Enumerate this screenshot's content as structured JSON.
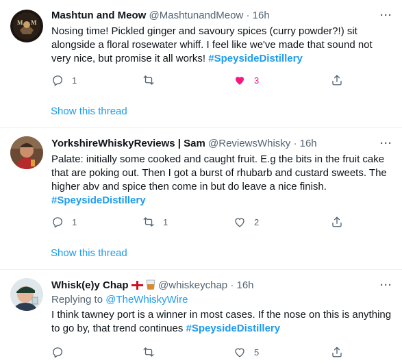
{
  "tweets": [
    {
      "name": "Mashtun and Meow",
      "handle": "@MashtunandMeow",
      "dot": "·",
      "time": "16h",
      "more": "···",
      "text": "Nosing time! Pickled ginger and savoury spices (curry powder?!) sit alongside a floral rosewater whiff. I feel like we've made that sound not very nice, but promise it all works! ",
      "hashtag": "#SpeysideDistillery",
      "reply_count": "1",
      "retweet_count": "",
      "like_count": "3",
      "liked": true,
      "show_thread": "Show this thread"
    },
    {
      "name": "YorkshireWhiskyReviews | Sam",
      "handle": "@ReviewsWhisky",
      "dot": "·",
      "time": "16h",
      "more": "···",
      "text": "Palate: initially some cooked and caught fruit. E.g the bits in the fruit cake that are poking out. Then I got a burst of rhubarb and custard sweets. The higher abv and spice then come in but do leave a nice finish. ",
      "hashtag": "#SpeysideDistillery",
      "reply_count": "1",
      "retweet_count": "1",
      "like_count": "2",
      "liked": false,
      "show_thread": "Show this thread"
    },
    {
      "name": "Whisk(e)y Chap",
      "handle": "@whiskeychap",
      "dot": "·",
      "time": "16h",
      "more": "···",
      "replying_prefix": "Replying to ",
      "replying_to": "@TheWhiskyWire",
      "text": "I think tawney port is a winner in most cases. If the nose on this is anything to go by, that trend continues ",
      "hashtag": "#SpeysideDistillery",
      "reply_count": "",
      "retweet_count": "",
      "like_count": "5",
      "liked": false
    }
  ],
  "colors": {
    "accent": "#1d9bf0",
    "muted": "#536471",
    "like_pink": "#f91880",
    "divider": "#eff3f4"
  },
  "icons": [
    "reply-icon",
    "retweet-icon",
    "like-icon",
    "share-icon",
    "more-icon",
    "england-flag-icon",
    "whisky-glass-icon"
  ]
}
